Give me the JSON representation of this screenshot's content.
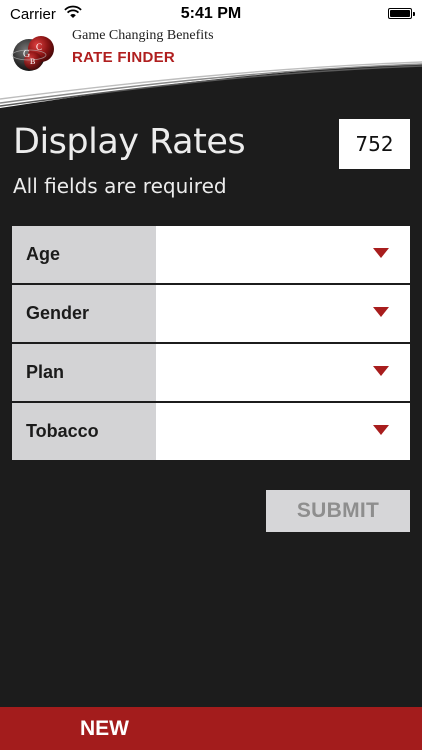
{
  "status_bar": {
    "carrier": "Carrier",
    "time": "5:41 PM"
  },
  "header": {
    "brand_name": "Game Changing Benefits",
    "app_name": "RATE FINDER",
    "logo_icon": "gcb-sphere-logo-icon"
  },
  "main": {
    "title": "Display Rates",
    "subtitle": "All fields are required",
    "code_value": "752"
  },
  "form": {
    "fields": [
      {
        "label": "Age",
        "value": ""
      },
      {
        "label": "Gender",
        "value": ""
      },
      {
        "label": "Plan",
        "value": ""
      },
      {
        "label": "Tobacco",
        "value": ""
      }
    ],
    "dropdown_icon": "chevron-down-icon"
  },
  "submit": {
    "label": "SUBMIT"
  },
  "bottom_bar": {
    "label": "NEW"
  },
  "colors": {
    "background": "#1c1c1c",
    "accent_red": "#a31c1c",
    "label_gray": "#d3d3d5",
    "text_light": "#ececec"
  }
}
